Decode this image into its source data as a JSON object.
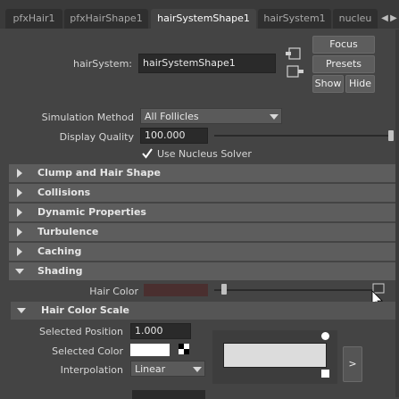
{
  "tabs": [
    "pfxHair1",
    "pfxHairShape1",
    "hairSystemShape1",
    "hairSystem1",
    "nucleu"
  ],
  "header": {
    "hairsystem_label": "hairSystem:",
    "hairsystem_value": "hairSystemShape1",
    "focus": "Focus",
    "presets": "Presets",
    "show": "Show",
    "hide": "Hide"
  },
  "attributes": {
    "simulation_method_label": "Simulation Method",
    "simulation_method_value": "All Follicles",
    "display_quality_label": "Display Quality",
    "display_quality_value": "100.000",
    "display_quality_fraction": 1.0,
    "use_nucleus_label": "Use Nucleus Solver",
    "use_nucleus_checked": true
  },
  "sections": [
    {
      "label": "Clump and Hair Shape",
      "expanded": false
    },
    {
      "label": "Collisions",
      "expanded": false
    },
    {
      "label": "Dynamic Properties",
      "expanded": false
    },
    {
      "label": "Turbulence",
      "expanded": false
    },
    {
      "label": "Caching",
      "expanded": false
    },
    {
      "label": "Shading",
      "expanded": true
    }
  ],
  "shading": {
    "hair_color_label": "Hair Color",
    "hair_color_swatch": "#4a2f2f",
    "hair_color_scale_label": "Hair Color Scale",
    "selected_position_label": "Selected Position",
    "selected_position_value": "1.000",
    "selected_color_label": "Selected Color",
    "selected_color_swatch": "#ffffff",
    "interpolation_label": "Interpolation",
    "interpolation_value": "Linear",
    "ramp_expand_label": ">",
    "ramp_color": "#dcdcdc"
  }
}
